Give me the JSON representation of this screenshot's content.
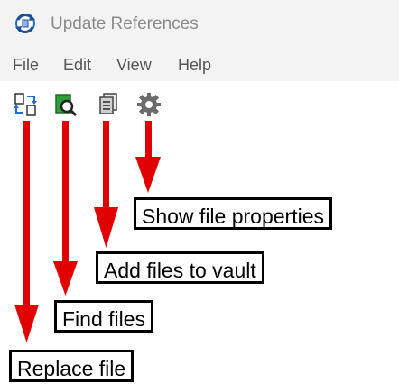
{
  "window": {
    "title": "Update References"
  },
  "menu": {
    "items": [
      "File",
      "Edit",
      "View",
      "Help"
    ]
  },
  "toolbar": {
    "buttons": [
      {
        "icon": "replace-file-icon"
      },
      {
        "icon": "find-files-icon"
      },
      {
        "icon": "add-files-to-vault-icon"
      },
      {
        "icon": "show-file-properties-icon"
      }
    ]
  },
  "annotations": {
    "show_properties": "Show file properties",
    "add_files": "Add files to vault",
    "find_files": "Find files",
    "replace_file": "Replace file"
  },
  "colors": {
    "arrow": "#e00000",
    "chrome": "#f3f3f3",
    "callout_border": "#000000"
  }
}
